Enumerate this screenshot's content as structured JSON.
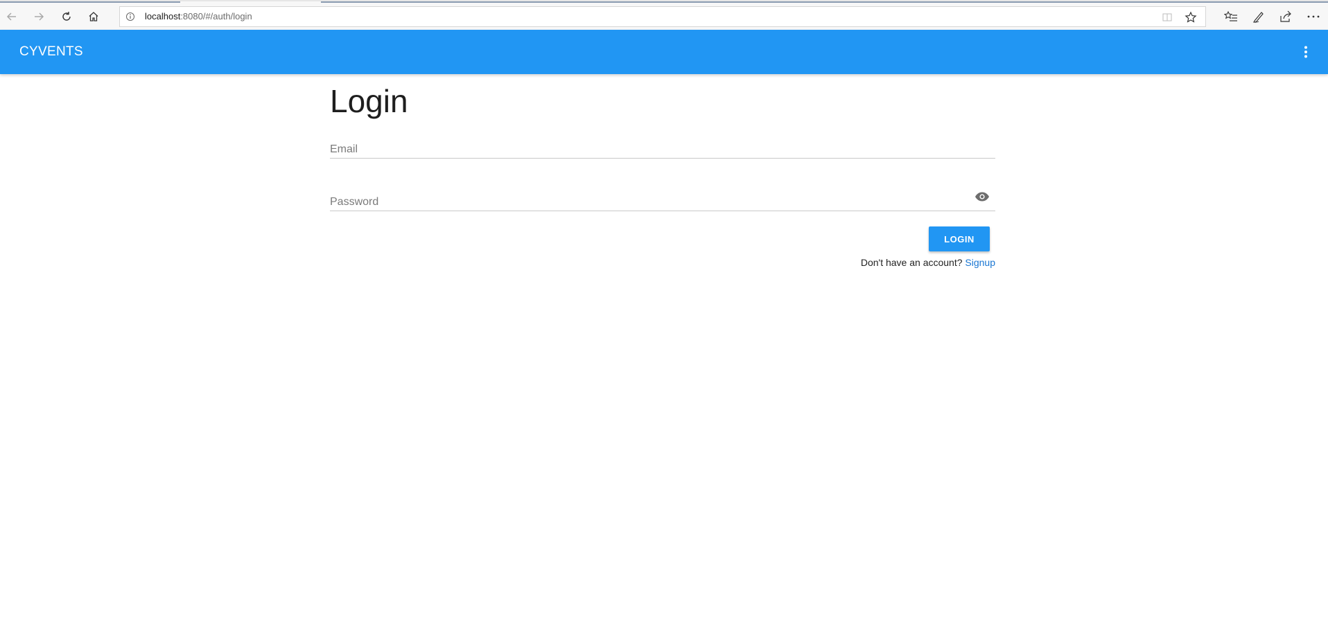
{
  "browser": {
    "url_host": "localhost",
    "url_rest": ":8080/#/auth/login",
    "icons": {
      "back": "arrow-left-icon",
      "forward": "arrow-right-icon",
      "refresh": "refresh-icon",
      "home": "home-icon",
      "site_info": "info-icon",
      "reading_view": "reading-view-icon",
      "favorite": "star-icon",
      "favorites_list": "favorites-list-icon",
      "notes": "pen-icon",
      "share": "share-icon",
      "more": "ellipsis-icon"
    }
  },
  "app": {
    "title": "CYVENTS",
    "accent_color": "#2196f3",
    "menu_icon": "kebab-menu-icon"
  },
  "login": {
    "heading": "Login",
    "email_placeholder": "Email",
    "password_placeholder": "Password",
    "show_password_icon": "eye-icon",
    "login_button": "LOGIN",
    "no_account_text": "Don't have an account?",
    "signup_link": "Signup",
    "link_color": "#1976d2"
  }
}
